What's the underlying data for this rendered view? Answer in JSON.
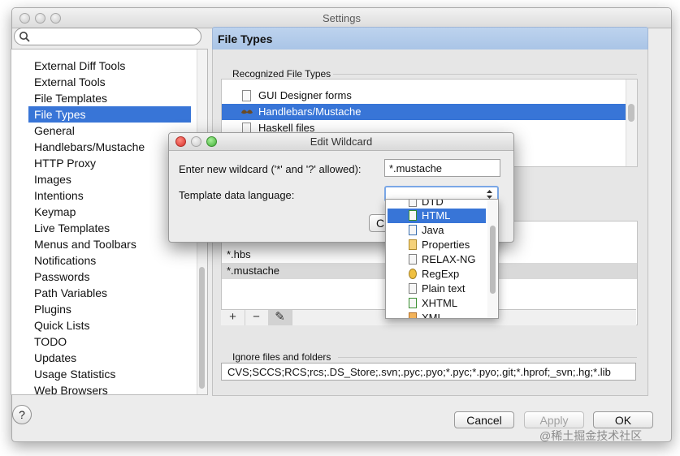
{
  "window": {
    "title": "Settings"
  },
  "search": {
    "placeholder": "",
    "value": ""
  },
  "sidebar": {
    "items": [
      {
        "label": "External Diff Tools"
      },
      {
        "label": "External Tools"
      },
      {
        "label": "File Templates"
      },
      {
        "label": "File Types",
        "selected": true
      },
      {
        "label": "General"
      },
      {
        "label": "Handlebars/Mustache"
      },
      {
        "label": "HTTP Proxy"
      },
      {
        "label": "Images"
      },
      {
        "label": "Intentions"
      },
      {
        "label": "Keymap"
      },
      {
        "label": "Live Templates"
      },
      {
        "label": "Menus and Toolbars"
      },
      {
        "label": "Notifications"
      },
      {
        "label": "Passwords"
      },
      {
        "label": "Path Variables"
      },
      {
        "label": "Plugins"
      },
      {
        "label": "Quick Lists"
      },
      {
        "label": "TODO"
      },
      {
        "label": "Updates"
      },
      {
        "label": "Usage Statistics"
      },
      {
        "label": "Web Browsers"
      }
    ]
  },
  "panel": {
    "title": "File Types",
    "recognized_label": "Recognized File Types",
    "file_types": [
      {
        "label": "GUI Designer forms",
        "icon": "form-file-icon"
      },
      {
        "label": "Handlebars/Mustache",
        "icon": "mustache-icon",
        "selected": true
      },
      {
        "label": "Haskell files",
        "icon": "haskell-file-icon"
      }
    ],
    "patterns": [
      {
        "label": "*.hbs"
      },
      {
        "label": "*.mustache",
        "selected": true
      }
    ],
    "toolbar": {
      "add": "+",
      "remove": "−",
      "edit": "✎"
    },
    "ignore_label": "Ignore files and folders",
    "ignore_value": "CVS;SCCS;RCS;rcs;.DS_Store;.svn;.pyc;.pyo;*.pyc;*.pyo;.git;*.hprof;_svn;.hg;*.lib"
  },
  "buttons": {
    "help": "?",
    "cancel": "Cancel",
    "apply": "Apply",
    "ok": "OK"
  },
  "dialog": {
    "title": "Edit Wildcard",
    "wildcard_label": "Enter new wildcard ('*' and '?' allowed):",
    "wildcard_value": "*.mustache",
    "language_label": "Template data language:",
    "hidden_button_fragment": "C",
    "dropdown_items": [
      {
        "label": "DTD",
        "icon": "dtd-file-icon"
      },
      {
        "label": "HTML",
        "icon": "html-file-icon",
        "selected": true
      },
      {
        "label": "Java",
        "icon": "java-file-icon"
      },
      {
        "label": "Properties",
        "icon": "properties-file-icon"
      },
      {
        "label": "RELAX-NG",
        "icon": "relaxng-file-icon"
      },
      {
        "label": "RegExp",
        "icon": "regexp-icon"
      },
      {
        "label": "Plain text",
        "icon": "text-file-icon"
      },
      {
        "label": "XHTML",
        "icon": "xhtml-file-icon"
      },
      {
        "label": "XML",
        "icon": "xml-file-icon"
      }
    ]
  },
  "watermark": "@稀土掘金技术社区",
  "colors": {
    "selection": "#3875d7",
    "header": "#b4cceb"
  }
}
